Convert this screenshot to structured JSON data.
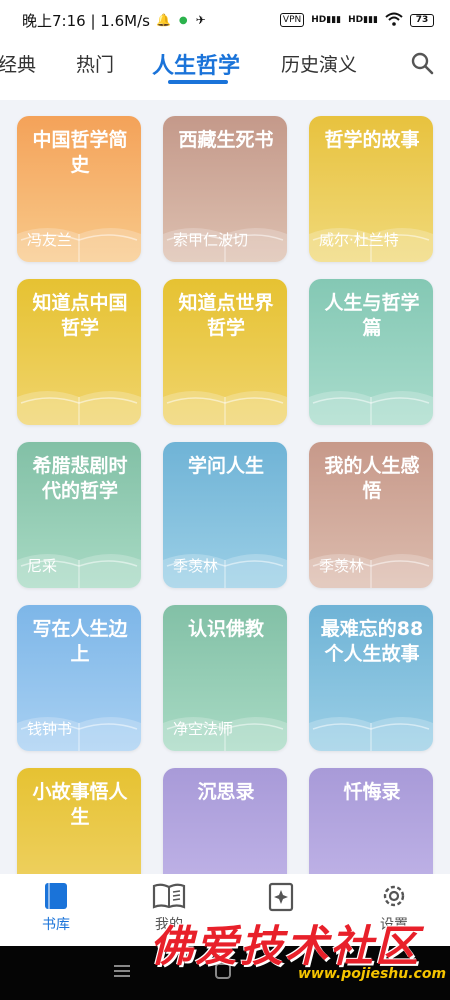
{
  "status": {
    "time": "晚上7:16 | 1.6M/s",
    "vpn": "VPN",
    "signal1": "HD",
    "signal2": "HD",
    "battery": "73"
  },
  "tabs": [
    {
      "label": "经典",
      "active": false
    },
    {
      "label": "热门",
      "active": false
    },
    {
      "label": "人生哲学",
      "active": true
    },
    {
      "label": "历史演义",
      "active": false
    }
  ],
  "books": [
    {
      "title": "中国哲学简史",
      "author": "冯友兰",
      "color_top": "#f4a259",
      "color_bottom": "#f8c98a"
    },
    {
      "title": "西藏生死书",
      "author": "索甲仁波切",
      "color_top": "#c4998a",
      "color_bottom": "#ddc0b0"
    },
    {
      "title": "哲学的故事",
      "author": "威尔·杜兰特",
      "color_top": "#e8c23e",
      "color_bottom": "#f0d97a"
    },
    {
      "title": "知道点中国哲学",
      "author": "",
      "color_top": "#e6c232",
      "color_bottom": "#f0d46c"
    },
    {
      "title": "知道点世界哲学",
      "author": "",
      "color_top": "#e6c232",
      "color_bottom": "#f0d46c"
    },
    {
      "title": "人生与哲学篇",
      "author": "",
      "color_top": "#84c8b4",
      "color_bottom": "#a9dccc"
    },
    {
      "title": "希腊悲剧时代的哲学",
      "author": "尼采",
      "color_top": "#82c0a6",
      "color_bottom": "#a8dac4"
    },
    {
      "title": "学问人生",
      "author": "季羡林",
      "color_top": "#6fb3d6",
      "color_bottom": "#9bcfe6"
    },
    {
      "title": "我的人生感悟",
      "author": "季羡林",
      "color_top": "#c7998a",
      "color_bottom": "#dcbcae"
    },
    {
      "title": "写在人生边上",
      "author": "钱钟书",
      "color_top": "#7db6e8",
      "color_bottom": "#a8d0f2"
    },
    {
      "title": "认识佛教",
      "author": "净空法师",
      "color_top": "#82c0a6",
      "color_bottom": "#a8dac4"
    },
    {
      "title": "最难忘的88个人生故事",
      "author": "",
      "color_top": "#6fb3d6",
      "color_bottom": "#9bcfe6"
    },
    {
      "title": "小故事悟人生",
      "author": "",
      "color_top": "#e6c232",
      "color_bottom": "#f0d46c"
    },
    {
      "title": "沉思录",
      "author": "",
      "color_top": "#a89ad8",
      "color_bottom": "#c4b8ea"
    },
    {
      "title": "忏悔录",
      "author": "",
      "color_top": "#a89ad8",
      "color_bottom": "#c4b8ea"
    }
  ],
  "nav": [
    {
      "label": "书库",
      "icon": "library-icon",
      "active": true
    },
    {
      "label": "我的",
      "icon": "open-book-icon",
      "active": false
    },
    {
      "label": "",
      "icon": "sparkle-book-icon",
      "active": false
    },
    {
      "label": "设置",
      "icon": "gear-icon",
      "active": false
    }
  ],
  "watermark": {
    "title": "佛爱技术社区",
    "url": "www.pojieshu.com"
  },
  "colors": {
    "accent": "#1a73d9"
  }
}
